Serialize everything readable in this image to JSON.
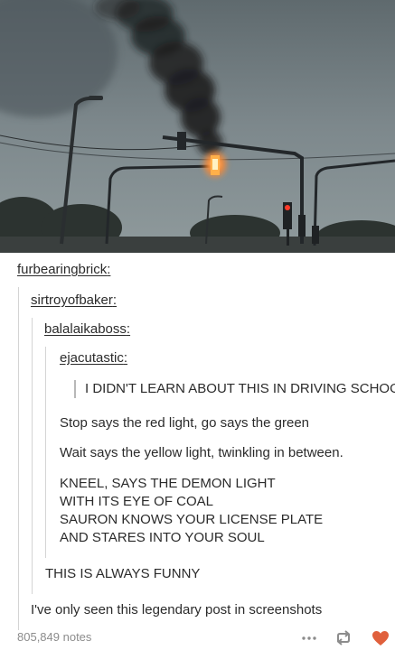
{
  "thread": {
    "users": [
      "furbearingbrick",
      "sirtroyofbaker",
      "balalaikaboss",
      "ejacutastic"
    ],
    "user_suffix": ":",
    "quote": "I DIDN'T LEARN ABOUT THIS IN DRIVING SCHOOL",
    "poem_line_1": "Stop says the red light, go says the green",
    "poem_line_2": "Wait says the yellow light, twinkling in between.",
    "demon_lines": [
      "KNEEL, SAYS THE DEMON LIGHT",
      "WITH ITS EYE OF COAL",
      "SAURON KNOWS YOUR LICENSE PLATE",
      "AND STARES INTO YOUR SOUL"
    ],
    "reblog_comment": "THIS IS ALWAYS FUNNY",
    "final_comment": "I've only seen this legendary post in screenshots"
  },
  "footer": {
    "notes": "805,849 notes",
    "icons": [
      "more-icon",
      "reblog-icon",
      "heart-icon"
    ],
    "heart_color": "#e0603c",
    "text_color": "#8c8c8c"
  }
}
